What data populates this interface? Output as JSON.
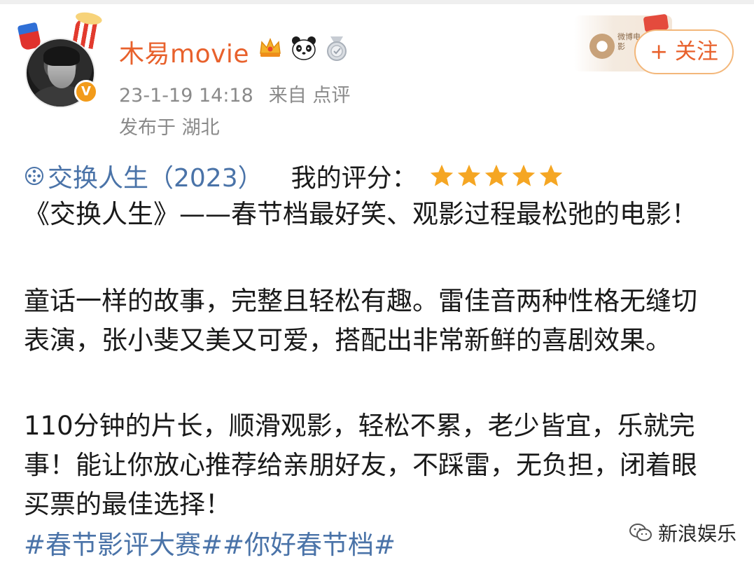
{
  "post": {
    "author": {
      "username": "木易movie",
      "avatar_icon": "avatar-portrait",
      "verified_badge": "V",
      "badges": [
        "crown-icon",
        "panda-icon",
        "medal-icon"
      ]
    },
    "timestamp": "23-1-19 14:18",
    "source": "来自 点评",
    "location": "发布于 湖北",
    "follow_label": "+ 关注",
    "follow_deco_text": "微博电影"
  },
  "review": {
    "movie_title": "交换人生（2023）",
    "rating_label": "我的评分：",
    "stars": 5,
    "star_color": "#f5a623",
    "lines": [
      "《交换人生》——春节档最好笑、观影过程最松弛的电影！",
      "童话一样的故事，完整且轻松有趣。雷佳音两种性格无缝切",
      "表演，张小斐又美又可爱，搭配出非常新鲜的喜剧效果。",
      "110分钟的片长，顺滑观影，轻松不累，老少皆宜，乐就完",
      "事！能让你放心推荐给亲朋好友，不踩雷，无负担，闭着眼",
      "买票的最佳选择！"
    ],
    "hashtags": "#春节影评大赛##你好春节档#"
  },
  "watermark": {
    "text": "新浪娱乐",
    "icon": "wechat-icon"
  },
  "colors": {
    "username": "#e8612c",
    "link": "#4a73a8",
    "meta": "#8a8a8a",
    "follow_border": "#f3b77a"
  }
}
